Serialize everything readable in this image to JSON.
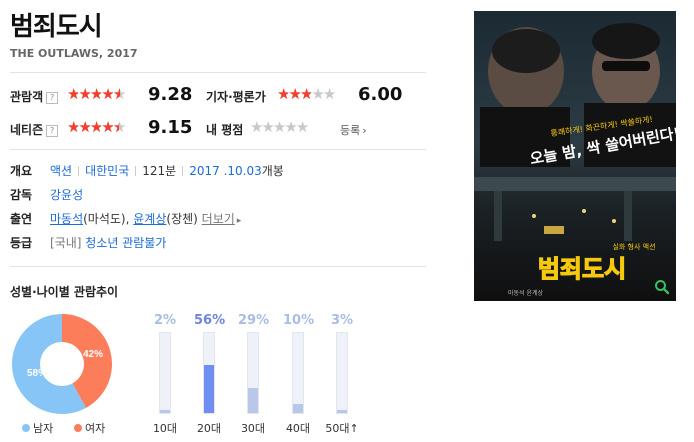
{
  "movie": {
    "title": "범죄도시",
    "subtitle": "THE OUTLAWS, 2017"
  },
  "ratings": {
    "audience": {
      "label": "관람객",
      "help": "?",
      "score": "9.28",
      "stars": 4.64
    },
    "critic": {
      "label": "기자·평론가",
      "score": "6.00",
      "stars": 3.0
    },
    "netizen": {
      "label": "네티즌",
      "help": "?",
      "score": "9.15",
      "stars": 4.58
    },
    "mine": {
      "label": "내 평점",
      "link": "등록",
      "arrow": "›",
      "stars": 0
    }
  },
  "info": {
    "overview": {
      "label": "개요",
      "genre": "액션",
      "country": "대한민국",
      "runtime": "121분",
      "release_date": "2017 .10.03",
      "release_suffix": "개봉"
    },
    "director": {
      "label": "감독",
      "name": "강윤성"
    },
    "cast": {
      "label": "출연",
      "actor1": "마동석",
      "role1": "(마석도)",
      "comma": ",",
      "actor2": "윤계상",
      "role2": "(장첸)",
      "more": "더보기",
      "more_arrow": "▸"
    },
    "rating": {
      "label": "등급",
      "region": "[국내]",
      "grade": "청소년 관람불가"
    }
  },
  "demographics": {
    "title": "성별·나이별 관람추이",
    "gender": [
      {
        "label": "남자",
        "percent": "58%",
        "value": 58,
        "color": "#86c5f5"
      },
      {
        "label": "여자",
        "percent": "42%",
        "value": 42,
        "color": "#fb7d5a"
      }
    ],
    "ages": [
      {
        "label": "10대",
        "percent": "2%",
        "value": 2
      },
      {
        "label": "20대",
        "percent": "56%",
        "value": 56,
        "highlight": true
      },
      {
        "label": "30대",
        "percent": "29%",
        "value": 29
      },
      {
        "label": "40대",
        "percent": "10%",
        "value": 10
      },
      {
        "label": "50대↑",
        "percent": "3%",
        "value": 3
      }
    ]
  },
  "poster": {
    "tagline1": "통쾌하게! 화끈하게! 싹쓸하게!",
    "headline": "오늘 밤, 싹 쓸어버린다!",
    "genre_tag": "실화 형사 액션",
    "title": "범죄도시",
    "credits": "마동석 윤계상",
    "zoom_icon": "magnifier-icon",
    "accent_yellow": "#f6c90e",
    "accent_green": "#36c060"
  }
}
